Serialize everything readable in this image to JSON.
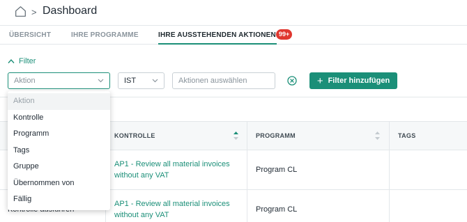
{
  "breadcrumb": {
    "separator": ">",
    "title": "Dashboard"
  },
  "tabs": [
    {
      "label": "ÜBERSICHT",
      "active": false
    },
    {
      "label": "IHRE PROGRAMME",
      "active": false
    },
    {
      "label": "IHRE AUSSTEHENDEN AKTIONEN",
      "active": true,
      "badge": "99+"
    }
  ],
  "filter": {
    "toggle_label": "Filter",
    "field_select_placeholder": "Aktion",
    "operator_value": "IST",
    "value_placeholder": "Aktionen auswählen",
    "add_button_label": "Filter hinzufügen"
  },
  "dropdown": {
    "placeholder": "Aktion",
    "options": [
      "Kontrolle",
      "Programm",
      "Tags",
      "Gruppe",
      "Übernommen von",
      "Fällig"
    ]
  },
  "table": {
    "columns": [
      "KONTROLLE",
      "PROGRAMM",
      "TAGS"
    ],
    "rows": [
      {
        "kontrolle": "AP1 - Review all material invoices without any VAT",
        "programm": "Program CL",
        "tags": ""
      },
      {
        "kontrolle": "AP1 - Review all material invoices without any VAT",
        "programm": "Program CL",
        "tags": ""
      }
    ],
    "partial_row_action": "Kontrolle ausführen"
  },
  "colors": {
    "accent": "#1b8f78",
    "badge": "#e0372f",
    "header_bg": "#f6f8f9"
  }
}
